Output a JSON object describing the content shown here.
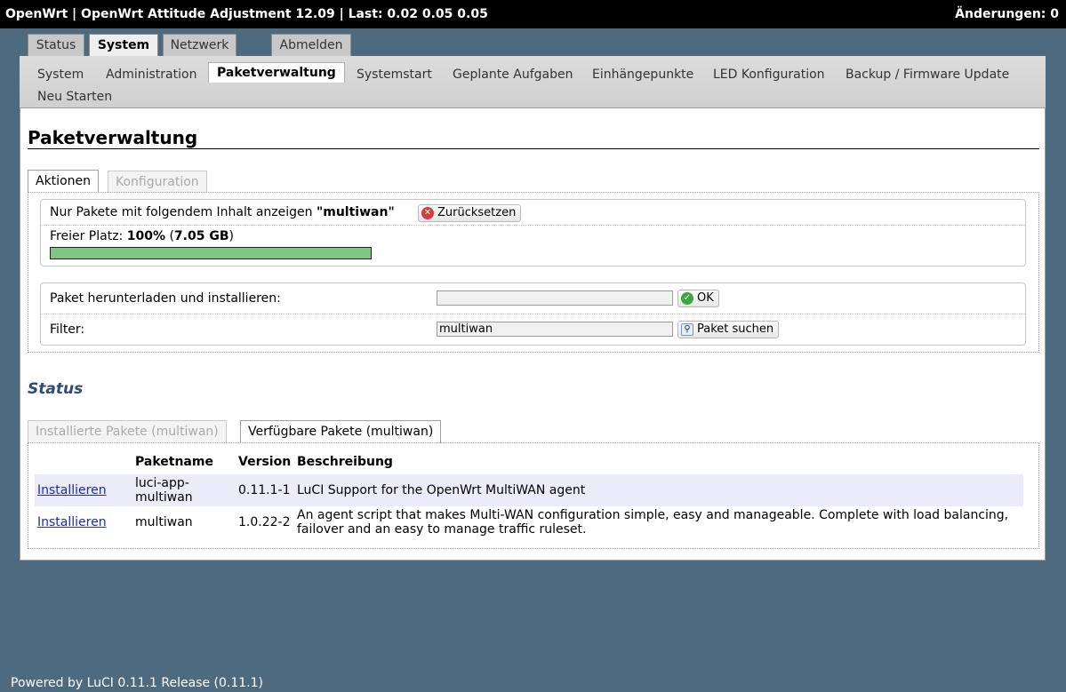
{
  "header": {
    "title": "OpenWrt | OpenWrt Attitude Adjustment 12.09 | Last: 0.02 0.05 0.05",
    "changes": "Änderungen: 0"
  },
  "main_tabs": [
    "Status",
    "System",
    "Netzwerk",
    "Abmelden"
  ],
  "sub_tabs": [
    "System",
    "Administration",
    "Paketverwaltung",
    "Systemstart",
    "Geplante Aufgaben",
    "Einhängepunkte",
    "LED Konfiguration",
    "Backup / Firmware Update",
    "Neu Starten"
  ],
  "page": {
    "title": "Paketverwaltung",
    "tabs": [
      "Aktionen",
      "Konfiguration"
    ],
    "filter_notice": {
      "prefix": "Nur Pakete mit folgendem Inhalt anzeigen",
      "term": "\"multiwan\"",
      "reset_label": "Zurücksetzen"
    },
    "free_space": {
      "label": "Freier Platz:",
      "percent": "100%",
      "paren_open": "(",
      "size": "7.05 GB",
      "paren_close": ")",
      "fraction": 1.0
    },
    "download": {
      "label": "Paket herunterladen und installieren:",
      "value": "",
      "ok_label": "OK"
    },
    "filter": {
      "label": "Filter:",
      "value": "multiwan",
      "search_label": "Paket suchen"
    }
  },
  "status": {
    "heading": "Status",
    "tabs": [
      "Installierte Pakete (multiwan)",
      "Verfügbare Pakete (multiwan)"
    ],
    "columns": [
      "",
      "Paketname",
      "Version",
      "Beschreibung"
    ],
    "rows": [
      {
        "action": "Installieren",
        "name_line1": "luci-app-",
        "name_line2": "multiwan",
        "version": "0.11.1-1",
        "description": "LuCI Support for the OpenWrt MultiWAN agent"
      },
      {
        "action": "Installieren",
        "name_line1": "multiwan",
        "name_line2": "",
        "version": "1.0.22-2",
        "description_line1": "An agent script that makes Multi-WAN configuration simple, easy and manageable. Complete with load balancing,",
        "description_line2": "failover and an easy to manage traffic ruleset."
      }
    ]
  },
  "footer": "Powered by LuCI 0.11.1 Release (0.11.1)",
  "colors": {
    "background": "#4e6a7e",
    "progress_fill": "#81c784",
    "status_heading": "#2c4a7a",
    "link": "#1a2bb0"
  }
}
